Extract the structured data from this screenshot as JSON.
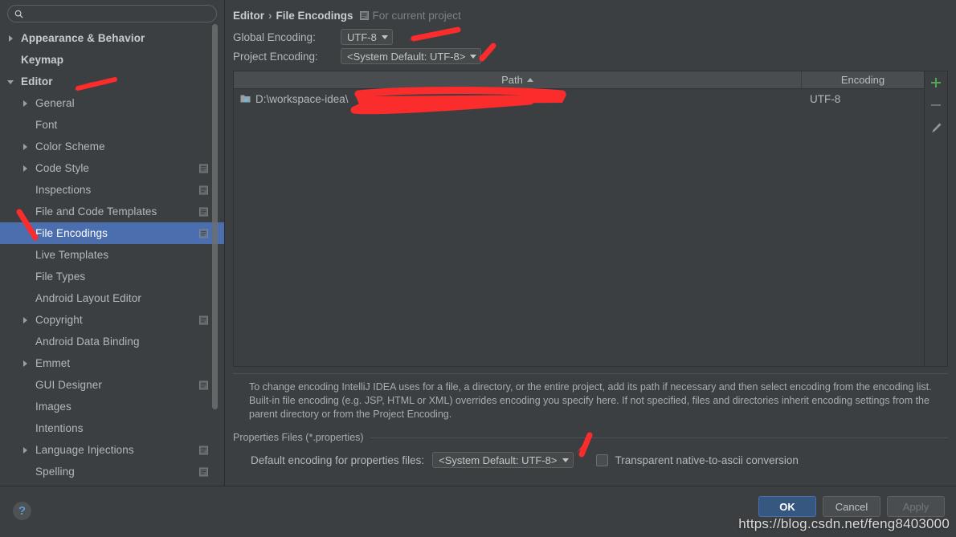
{
  "window": {
    "title": "Settings - File Encodings"
  },
  "search": {
    "value": "",
    "placeholder": "",
    "icon": "search-icon"
  },
  "sidebar": {
    "items": [
      {
        "label": "Appearance & Behavior",
        "level": 0,
        "arrow": "right",
        "badge": false,
        "selected": false
      },
      {
        "label": "Keymap",
        "level": 0,
        "arrow": "none",
        "badge": false,
        "selected": false
      },
      {
        "label": "Editor",
        "level": 0,
        "arrow": "down",
        "badge": false,
        "selected": false
      },
      {
        "label": "General",
        "level": 1,
        "arrow": "right",
        "badge": false,
        "selected": false
      },
      {
        "label": "Font",
        "level": 1,
        "arrow": "none",
        "badge": false,
        "selected": false
      },
      {
        "label": "Color Scheme",
        "level": 1,
        "arrow": "right",
        "badge": false,
        "selected": false
      },
      {
        "label": "Code Style",
        "level": 1,
        "arrow": "right",
        "badge": true,
        "selected": false
      },
      {
        "label": "Inspections",
        "level": 1,
        "arrow": "none",
        "badge": true,
        "selected": false
      },
      {
        "label": "File and Code Templates",
        "level": 1,
        "arrow": "none",
        "badge": true,
        "selected": false
      },
      {
        "label": "File Encodings",
        "level": 1,
        "arrow": "none",
        "badge": true,
        "selected": true
      },
      {
        "label": "Live Templates",
        "level": 1,
        "arrow": "none",
        "badge": false,
        "selected": false
      },
      {
        "label": "File Types",
        "level": 1,
        "arrow": "none",
        "badge": false,
        "selected": false
      },
      {
        "label": "Android Layout Editor",
        "level": 1,
        "arrow": "none",
        "badge": false,
        "selected": false
      },
      {
        "label": "Copyright",
        "level": 1,
        "arrow": "right",
        "badge": true,
        "selected": false
      },
      {
        "label": "Android Data Binding",
        "level": 1,
        "arrow": "none",
        "badge": false,
        "selected": false
      },
      {
        "label": "Emmet",
        "level": 1,
        "arrow": "right",
        "badge": false,
        "selected": false
      },
      {
        "label": "GUI Designer",
        "level": 1,
        "arrow": "none",
        "badge": true,
        "selected": false
      },
      {
        "label": "Images",
        "level": 1,
        "arrow": "none",
        "badge": false,
        "selected": false
      },
      {
        "label": "Intentions",
        "level": 1,
        "arrow": "none",
        "badge": false,
        "selected": false
      },
      {
        "label": "Language Injections",
        "level": 1,
        "arrow": "right",
        "badge": true,
        "selected": false
      },
      {
        "label": "Spelling",
        "level": 1,
        "arrow": "none",
        "badge": true,
        "selected": false
      }
    ]
  },
  "breadcrumb": {
    "parent": "Editor",
    "separator": "›",
    "current": "File Encodings",
    "note": "For current project",
    "note_icon": "project-scope-icon"
  },
  "encodings": {
    "global_label": "Global Encoding:",
    "global_value": "UTF-8",
    "project_label": "Project Encoding:",
    "project_value": "<System Default: UTF-8>"
  },
  "table": {
    "columns": [
      "Path",
      "Encoding"
    ],
    "sort_column": "Path",
    "sort_direction": "asc",
    "rows": [
      {
        "path": "D:\\workspace-idea\\",
        "path_redacted": true,
        "encoding": "UTF-8",
        "icon": "module-folder-icon"
      }
    ],
    "tools": [
      {
        "name": "add-button",
        "glyph": "+"
      },
      {
        "name": "remove-button",
        "glyph": "−"
      },
      {
        "name": "edit-button",
        "glyph": "pencil"
      }
    ]
  },
  "description": "To change encoding IntelliJ IDEA uses for a file, a directory, or the entire project, add its path if necessary and then select encoding from the encoding list. Built-in file encoding (e.g. JSP, HTML or XML) overrides encoding you specify here. If not specified, files and directories inherit encoding settings from the parent directory or from the Project Encoding.",
  "properties_section": {
    "legend": "Properties Files (*.properties)",
    "default_encoding_label": "Default encoding for properties files:",
    "default_encoding_value": "<System Default: UTF-8>",
    "transparent_label": "Transparent native-to-ascii conversion",
    "transparent_checked": false
  },
  "footer": {
    "help_glyph": "?",
    "ok": "OK",
    "cancel": "Cancel",
    "apply": "Apply"
  },
  "watermark": "https://blog.csdn.net/feng8403000",
  "colors": {
    "background": "#3c3f41",
    "selection": "#4b6eaf",
    "primary_button": "#365880",
    "annotation_red": "#fb2c2c",
    "add_green": "#53a653"
  }
}
